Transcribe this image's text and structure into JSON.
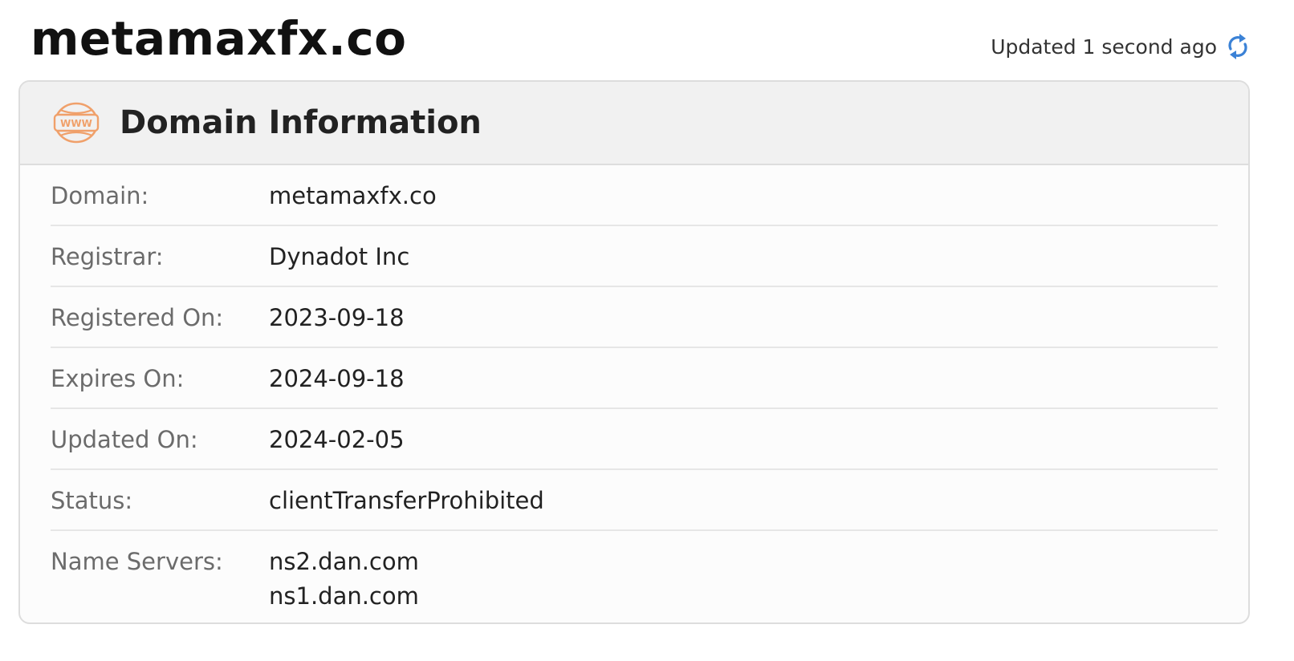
{
  "page": {
    "title": "metamaxfx.co",
    "updated_text": "Updated 1 second ago"
  },
  "card": {
    "title": "Domain Information",
    "icon_text": "WWW",
    "rows": [
      {
        "label": "Domain:",
        "values": [
          "metamaxfx.co"
        ]
      },
      {
        "label": "Registrar:",
        "values": [
          "Dynadot Inc"
        ]
      },
      {
        "label": "Registered On:",
        "values": [
          "2023-09-18"
        ]
      },
      {
        "label": "Expires On:",
        "values": [
          "2024-09-18"
        ]
      },
      {
        "label": "Updated On:",
        "values": [
          "2024-02-05"
        ]
      },
      {
        "label": "Status:",
        "values": [
          "clientTransferProhibited"
        ]
      },
      {
        "label": "Name Servers:",
        "values": [
          "ns2.dan.com",
          "ns1.dan.com"
        ]
      }
    ]
  },
  "icons": {
    "refresh": "refresh-icon",
    "www": "www-globe-icon"
  },
  "colors": {
    "accent_orange": "#f0a06a",
    "refresh_blue": "#3b82d6",
    "header_bg": "#f1f1f1",
    "label_gray": "#6b6b6b"
  }
}
